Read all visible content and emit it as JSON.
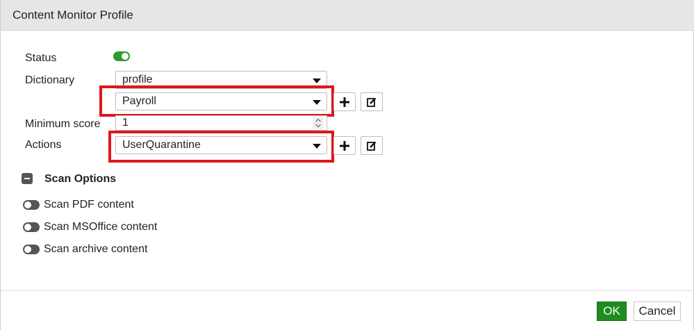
{
  "dialog": {
    "title": "Content Monitor Profile"
  },
  "form": {
    "status_label": "Status",
    "status_enabled": true,
    "dictionary_label": "Dictionary",
    "dictionary_type_value": "profile",
    "dictionary_value": "Payroll",
    "min_score_label": "Minimum score",
    "min_score_value": "1",
    "actions_label": "Actions",
    "actions_value": "UserQuarantine"
  },
  "scan_options": {
    "title": "Scan Options",
    "items": [
      {
        "label": "Scan PDF content",
        "enabled": false
      },
      {
        "label": "Scan MSOffice content",
        "enabled": false
      },
      {
        "label": "Scan archive content",
        "enabled": false
      }
    ]
  },
  "footer": {
    "ok_label": "OK",
    "cancel_label": "Cancel"
  },
  "colors": {
    "toggle_on": "#2e9a2e",
    "highlight": "#e0161b",
    "ok_button": "#1e8c1e"
  }
}
